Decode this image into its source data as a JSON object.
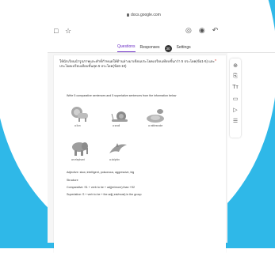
{
  "browser": {
    "url": "docs.google.com"
  },
  "toolbar": {
    "back_glyph": "□",
    "star_glyph": "☆",
    "palette_glyph": "◎",
    "preview_glyph": "◉",
    "undo_glyph": "↶"
  },
  "tabs": [
    {
      "label": "Questions",
      "active": true
    },
    {
      "label": "Responses",
      "active": false
    },
    {
      "label": "Settings",
      "active": false
    }
  ],
  "responses_badge": "30",
  "question": {
    "title": "ให้นักเรียนนำรูปภาพและคำที่กำหนดให้ด้านล่างมาเขียนประโยคเปรียบเทียบขั้นกว่า 5 ประโยค(ข้อ1-5) และประโยคเปรียบเทียบขั้นสุด 5 ประโยค(ข้อ6-10)",
    "required_marker": "*",
    "instruction": "Write 5 comparative sentences and 5 superlative sentences from the information below",
    "animals": [
      {
        "caption": "a lion",
        "icon": "lion-icon"
      },
      {
        "caption": "a snail",
        "icon": "snail-icon"
      },
      {
        "caption": "a rattlesnake",
        "icon": "snake-icon"
      },
      {
        "caption": "an elephant",
        "icon": "elephant-icon"
      },
      {
        "caption": "a dolphin",
        "icon": "dolphin-icon"
      }
    ],
    "adjectives": "Adjective: slow, intelligent, poisonous, aggressive, big",
    "structure_label": "Structure",
    "comparative": "Comparative: S1 + verb to be + adj(er/more) than +S2",
    "superlative": "Superlative: S + verb to be + the adj(-est/most) in the group"
  },
  "sidebar": [
    {
      "icon": "add-question-icon",
      "glyph": "⊕"
    },
    {
      "icon": "import-questions-icon",
      "glyph": "⎘"
    },
    {
      "icon": "add-title-icon",
      "glyph": "Tт"
    },
    {
      "icon": "add-image-icon",
      "glyph": "▭"
    },
    {
      "icon": "add-video-icon",
      "glyph": "▷"
    },
    {
      "icon": "add-section-icon",
      "glyph": "☰"
    }
  ]
}
